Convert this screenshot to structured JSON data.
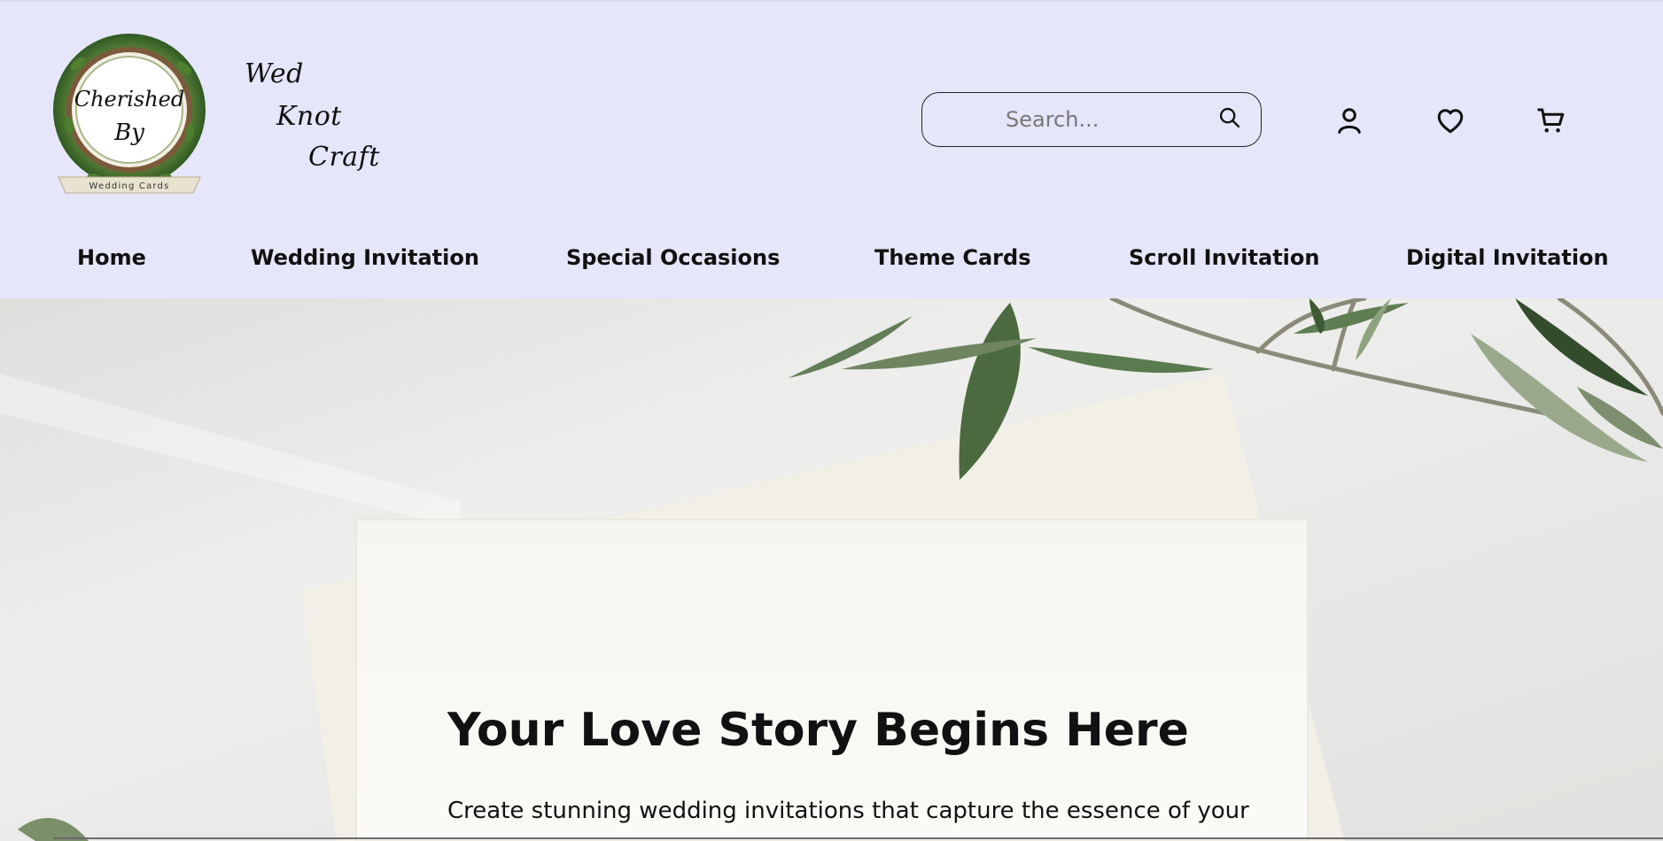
{
  "header": {
    "logo": {
      "badge_text_line1": "Cherished",
      "badge_text_line2": "By",
      "badge_ribbon": "Wedding Cards"
    },
    "brand": {
      "line1": "Wed",
      "line2": "Knot",
      "line3": "Craft"
    },
    "search": {
      "placeholder": "Search...",
      "value": ""
    },
    "icons": [
      "search-icon",
      "user-icon",
      "heart-icon",
      "cart-icon"
    ]
  },
  "nav": {
    "items": [
      {
        "label": "Home"
      },
      {
        "label": "Wedding Invitation"
      },
      {
        "label": "Special Occasions"
      },
      {
        "label": "Theme Cards"
      },
      {
        "label": "Scroll Invitation"
      },
      {
        "label": "Digital Invitation"
      }
    ]
  },
  "hero": {
    "title": "Your Love Story Begins Here",
    "description": "Create stunning wedding invitations that capture the essence of your"
  },
  "colors": {
    "header_bg": "#e6e6fa",
    "text": "#111111",
    "hero_bg": "#e4e5e3",
    "card": "#fbfaf7",
    "leaf": "#3f5e3a"
  }
}
